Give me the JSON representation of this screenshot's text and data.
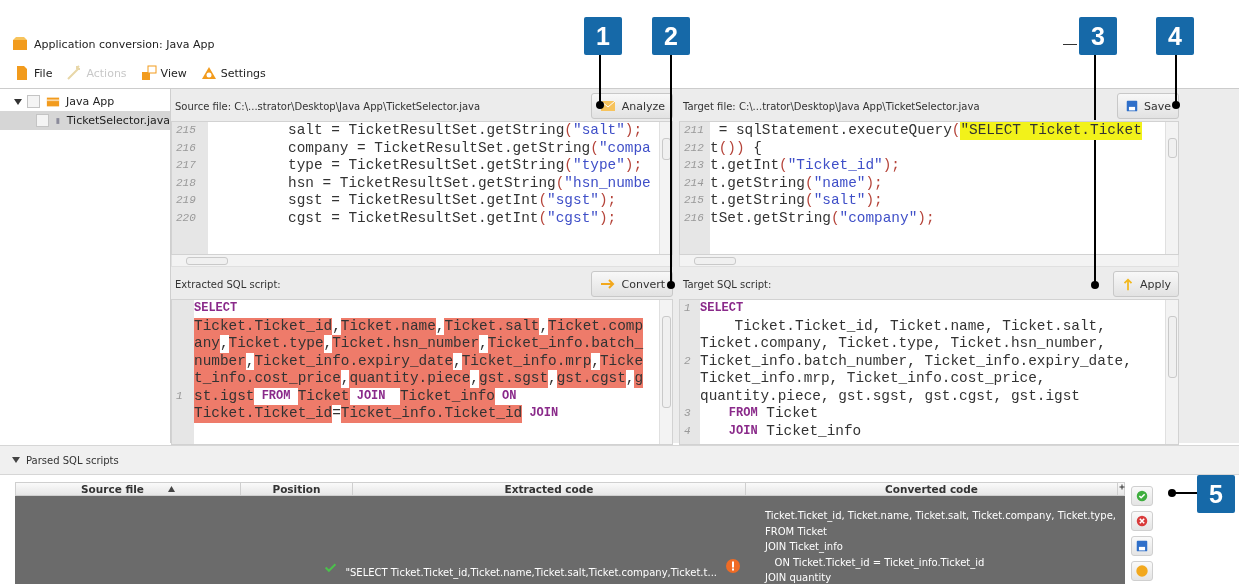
{
  "window": {
    "title": "Application conversion: Java App"
  },
  "toolbar": [
    {
      "label": "File",
      "kind": "file",
      "disabled": false
    },
    {
      "label": "Actions",
      "kind": "actions",
      "disabled": true
    },
    {
      "label": "View",
      "kind": "view",
      "disabled": false
    },
    {
      "label": "Settings",
      "kind": "settings",
      "disabled": false
    }
  ],
  "tree": [
    {
      "label": "Java App",
      "expanded": true,
      "checked": false,
      "selected": false,
      "children": [
        {
          "label": "TicketSelector.java",
          "checked": false,
          "selected": true
        }
      ]
    }
  ],
  "source_panel": {
    "title": "Source file: C:\\...strator\\Desktop\\Java App\\TicketSelector.java",
    "button": "Analyze",
    "rows": [
      {
        "n": "215",
        "segs": [
          {
            "text": "salt = TicketResultSet.getString",
            "kind": "plain"
          },
          {
            "text": "(",
            "kind": "punct"
          },
          {
            "text": "\"salt\"",
            "kind": "string"
          },
          {
            "text": ");",
            "kind": "punct"
          }
        ]
      },
      {
        "n": "216",
        "segs": [
          {
            "text": "company = TicketResultSet.getString",
            "kind": "plain"
          },
          {
            "text": "(",
            "kind": "punct"
          },
          {
            "text": "\"compa",
            "kind": "string"
          }
        ]
      },
      {
        "n": "217",
        "segs": [
          {
            "text": "type = TicketResultSet.getString",
            "kind": "plain"
          },
          {
            "text": "(",
            "kind": "punct"
          },
          {
            "text": "\"type\"",
            "kind": "string"
          },
          {
            "text": ");",
            "kind": "punct"
          }
        ]
      },
      {
        "n": "218",
        "segs": [
          {
            "text": "hsn = TicketResultSet.getString",
            "kind": "plain"
          },
          {
            "text": "(",
            "kind": "punct"
          },
          {
            "text": "\"hsn_numbe",
            "kind": "string"
          }
        ]
      },
      {
        "n": "219",
        "segs": [
          {
            "text": "sgst = TicketResultSet.getInt",
            "kind": "plain"
          },
          {
            "text": "(",
            "kind": "punct"
          },
          {
            "text": "\"sgst\"",
            "kind": "string"
          },
          {
            "text": ");",
            "kind": "punct"
          }
        ]
      },
      {
        "n": "220",
        "segs": [
          {
            "text": "cgst = TicketResultSet.getInt",
            "kind": "plain"
          },
          {
            "text": "(",
            "kind": "punct"
          },
          {
            "text": "\"cgst\"",
            "kind": "string"
          },
          {
            "text": ");",
            "kind": "punct"
          }
        ]
      }
    ]
  },
  "target_panel": {
    "title": "Target file: C:\\...trator\\Desktop\\Java App\\TicketSelector.java",
    "button": "Save",
    "rows": [
      {
        "n": "211",
        "segs": [
          {
            "text": " = sqlStatement.executeQuery",
            "kind": "plain"
          },
          {
            "text": "(",
            "kind": "punct"
          },
          {
            "text": "\"SELECT Ticket.Ticket",
            "kind": "highlight"
          }
        ]
      },
      {
        "n": "212",
        "segs": [
          {
            "text": "t",
            "kind": "plain"
          },
          {
            "text": "())",
            "kind": "punct"
          },
          {
            "text": " {",
            "kind": "plain"
          }
        ]
      },
      {
        "n": "213",
        "segs": [
          {
            "text": "t.getInt",
            "kind": "plain"
          },
          {
            "text": "(",
            "kind": "punct"
          },
          {
            "text": "\"Ticket_id\"",
            "kind": "string"
          },
          {
            "text": ");",
            "kind": "punct"
          }
        ]
      },
      {
        "n": "214",
        "segs": [
          {
            "text": "t.getString",
            "kind": "plain"
          },
          {
            "text": "(",
            "kind": "punct"
          },
          {
            "text": "\"name\"",
            "kind": "string"
          },
          {
            "text": ");",
            "kind": "punct"
          }
        ]
      },
      {
        "n": "215",
        "segs": [
          {
            "text": "t.getString",
            "kind": "plain"
          },
          {
            "text": "(",
            "kind": "punct"
          },
          {
            "text": "\"salt\"",
            "kind": "string"
          },
          {
            "text": ");",
            "kind": "punct"
          }
        ]
      },
      {
        "n": "216",
        "segs": [
          {
            "text": "tSet.getString",
            "kind": "plain"
          },
          {
            "text": "(",
            "kind": "punct"
          },
          {
            "text": "\"company\"",
            "kind": "string"
          },
          {
            "text": ");",
            "kind": "punct"
          }
        ]
      }
    ]
  },
  "extracted_panel": {
    "title": "Extracted SQL script:",
    "button": "Convert",
    "rows": [
      {
        "n": "",
        "segs": [
          {
            "text": "SELECT",
            "kind": "keyword"
          }
        ]
      },
      {
        "n": "",
        "segs": [
          {
            "text": "Ticket.Ticket_id",
            "kind": "marked",
            "sep": ","
          },
          {
            "text": "Ticket.name",
            "kind": "marked",
            "sep": ","
          },
          {
            "text": "Ticket.salt",
            "kind": "marked",
            "sep": ","
          },
          {
            "text": "Ticket.comp",
            "kind": "marked"
          }
        ]
      },
      {
        "n": "",
        "segs": [
          {
            "text": "any",
            "kind": "marked",
            "sep": ","
          },
          {
            "text": "Ticket.type",
            "kind": "marked",
            "sep": ","
          },
          {
            "text": "Ticket.hsn_number",
            "kind": "marked",
            "sep": ","
          },
          {
            "text": "Ticket_info.batch_",
            "kind": "marked"
          }
        ]
      },
      {
        "n": "",
        "segs": [
          {
            "text": "number",
            "kind": "marked",
            "sep": ","
          },
          {
            "text": "Ticket_info.expiry_date",
            "kind": "marked",
            "sep": ","
          },
          {
            "text": "Ticket_info.mrp",
            "kind": "marked",
            "sep": ","
          },
          {
            "text": "Ticke",
            "kind": "marked"
          }
        ]
      },
      {
        "n": "",
        "segs": [
          {
            "text": "t_info.cost_price",
            "kind": "marked",
            "sep": ","
          },
          {
            "text": "quantity.piece",
            "kind": "marked",
            "sep": ","
          },
          {
            "text": "gst.sgst",
            "kind": "marked",
            "sep": ","
          },
          {
            "text": "gst.cgst",
            "kind": "marked",
            "sep": ","
          },
          {
            "text": "g",
            "kind": "marked"
          }
        ]
      },
      {
        "n": "1",
        "segs": [
          {
            "text": "st.igst",
            "kind": "marked"
          },
          {
            "text": " FROM ",
            "kind": "keyword"
          },
          {
            "text": "Ticket",
            "kind": "marked"
          },
          {
            "text": " JOIN  ",
            "kind": "keyword"
          },
          {
            "text": "Ticket_info",
            "kind": "marked"
          },
          {
            "text": " ON",
            "kind": "keyword"
          }
        ]
      },
      {
        "n": "",
        "segs": [
          {
            "text": "Ticket.Ticket_id",
            "kind": "marked"
          },
          {
            "text": "=",
            "kind": "plain"
          },
          {
            "text": "Ticket_info.Ticket_id",
            "kind": "marked"
          },
          {
            "text": " JOIN",
            "kind": "keyword"
          }
        ]
      }
    ]
  },
  "target_sql_panel": {
    "title": "Target SQL script:",
    "button": "Apply",
    "rows": [
      {
        "n": "1",
        "segs": [
          {
            "text": "SELECT",
            "kind": "keyword"
          }
        ]
      },
      {
        "n": "",
        "segs": [
          {
            "text": "    Ticket.Ticket_id, Ticket.name, Ticket.salt,",
            "kind": "plain"
          }
        ]
      },
      {
        "n": "",
        "segs": [
          {
            "text": "Ticket.company, Ticket.type, Ticket.hsn_number,",
            "kind": "plain"
          }
        ]
      },
      {
        "n": "2",
        "segs": [
          {
            "text": "Ticket_info.batch_number, Ticket_info.expiry_date,",
            "kind": "plain"
          }
        ]
      },
      {
        "n": "",
        "segs": [
          {
            "text": "Ticket_info.mrp, Ticket_info.cost_price,",
            "kind": "plain"
          }
        ]
      },
      {
        "n": "",
        "segs": [
          {
            "text": "quantity.piece, gst.sgst, gst.cgst, gst.igst",
            "kind": "plain"
          }
        ]
      },
      {
        "n": "3",
        "segs": [
          {
            "text": "    FROM",
            "kind": "keyword"
          },
          {
            "text": " Ticket",
            "kind": "plain"
          }
        ]
      },
      {
        "n": "4",
        "segs": [
          {
            "text": "    JOIN",
            "kind": "keyword"
          },
          {
            "text": " Ticket_info",
            "kind": "plain"
          }
        ]
      }
    ]
  },
  "parsed_section": {
    "title": "Parsed SQL scripts",
    "expanded": true,
    "columns": [
      {
        "label": "Source file",
        "sorted": true
      },
      {
        "label": "Position",
        "sorted": false
      },
      {
        "label": "Extracted code",
        "sorted": false
      },
      {
        "label": "Converted code",
        "sorted": false
      }
    ],
    "rows": [
      {
        "selected": true,
        "extracted_code": "\"SELECT Ticket.Ticket_id,Ticket.name,Ticket.salt,Ticket.company,Ticket.t...",
        "passed": true,
        "warning": true,
        "converted_code": [
          "Ticket.Ticket_id, Ticket.name, Ticket.salt, Ticket.company, Ticket.type,",
          "FROM Ticket",
          "JOIN Ticket_info",
          "   ON Ticket.Ticket_id = Ticket_info.Ticket_id",
          "JOIN quantity"
        ]
      }
    ],
    "side_buttons": [
      {
        "kind": "accept"
      },
      {
        "kind": "reject"
      },
      {
        "kind": "save"
      },
      {
        "kind": "help"
      }
    ]
  },
  "callouts": [
    {
      "label": "1"
    },
    {
      "label": "2"
    },
    {
      "label": "3"
    },
    {
      "label": "4"
    },
    {
      "label": "5"
    }
  ]
}
